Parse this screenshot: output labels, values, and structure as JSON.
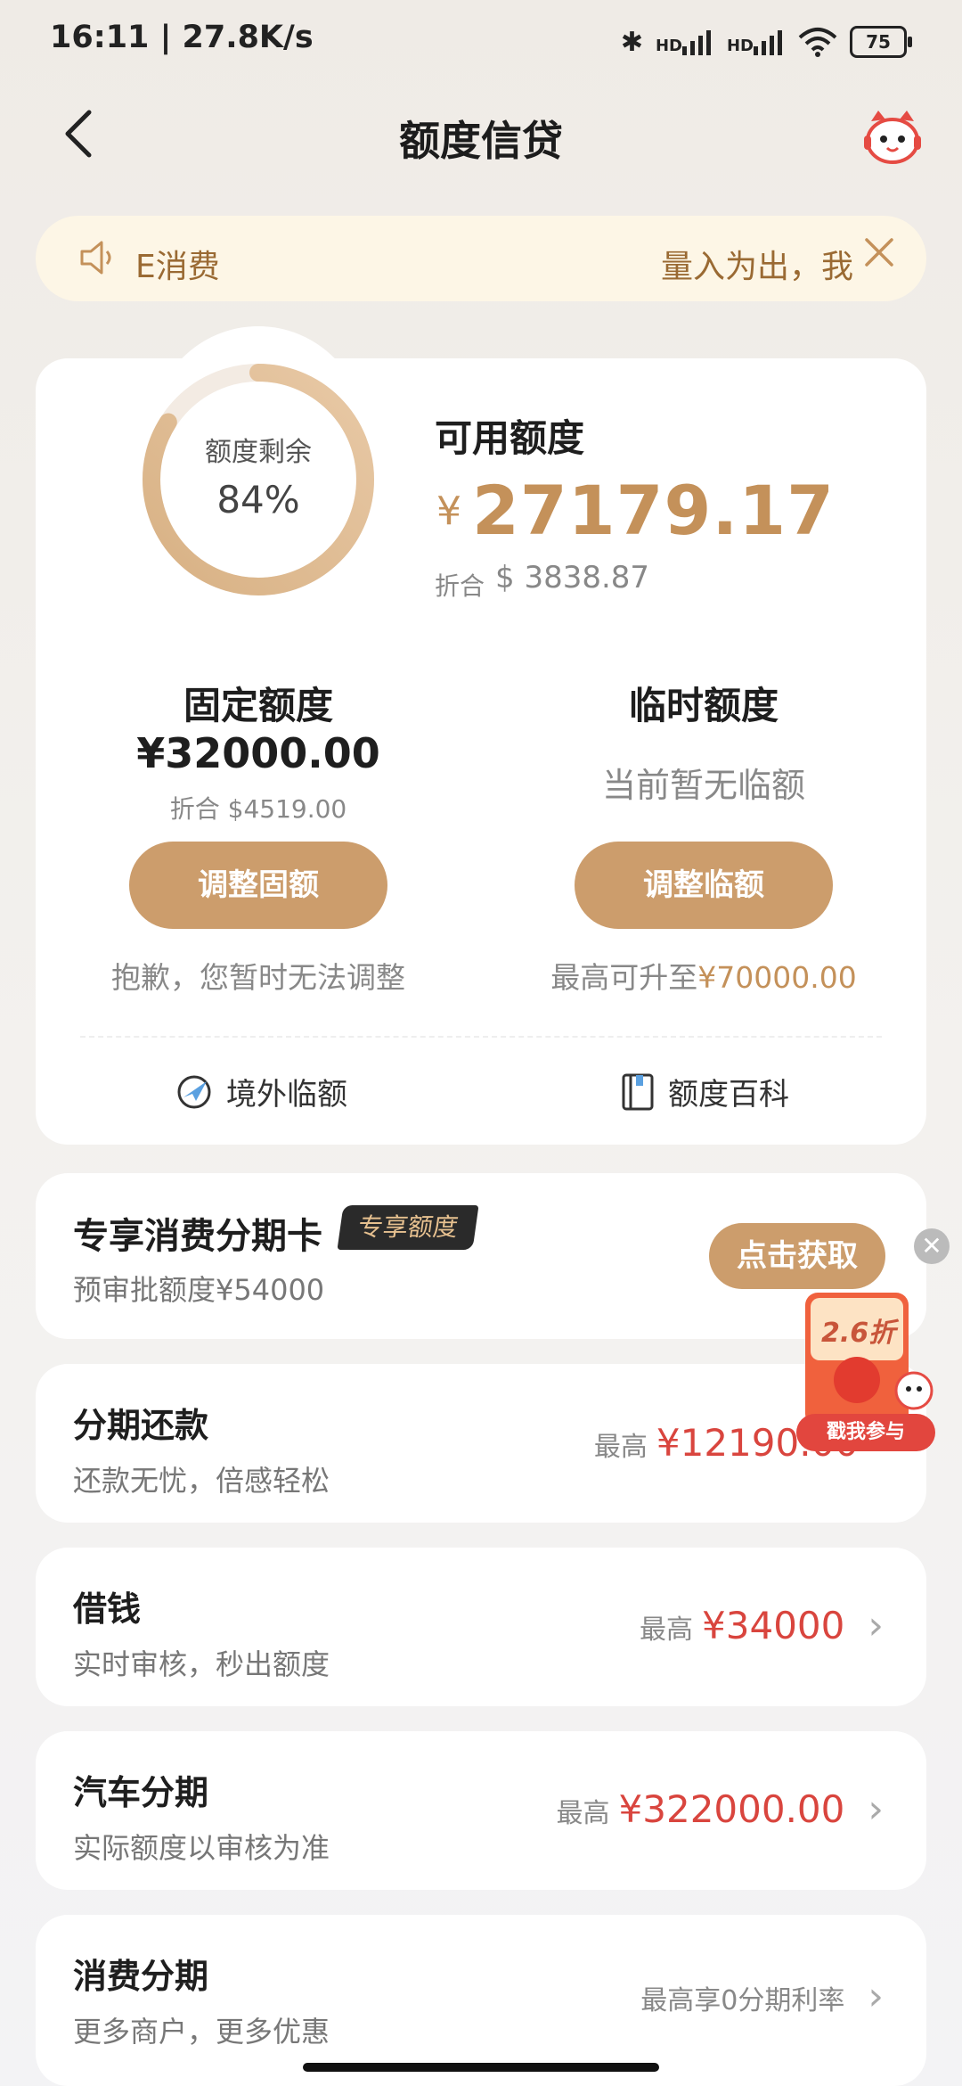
{
  "status_bar": {
    "time": "16:11 | 27.8K/s",
    "network_1": "HD",
    "network_2": "HD",
    "battery": "75"
  },
  "header": {
    "title": "额度信贷"
  },
  "notice": {
    "text_left": "E消费",
    "text_right": "量入为出，我"
  },
  "quota": {
    "ring_label": "额度剩余",
    "ring_percent": "84%",
    "ring_fraction": 0.84,
    "available_title": "可用额度",
    "currency_symbol": "¥",
    "available_value": "27179.17",
    "convert_label": "折合",
    "convert_value": "$ 3838.87",
    "fixed": {
      "title": "固定额度",
      "value": "¥32000.00",
      "convert": "折合 $4519.00",
      "button": "调整固额",
      "note": "抱歉，您暂时无法调整"
    },
    "temporary": {
      "title": "临时额度",
      "status": "当前暂无临额",
      "button": "调整临额",
      "note_prefix": "最高可升至",
      "note_value": "¥70000.00"
    },
    "links": {
      "overseas": "境外临额",
      "wiki": "额度百科"
    }
  },
  "promo": {
    "title": "专享消费分期卡",
    "badge": "专享额度",
    "subtitle": "预审批额度¥54000",
    "button": "点击获取"
  },
  "rows": [
    {
      "title": "分期还款",
      "subtitle": "还款无忧，倍感轻松",
      "prefix": "最高",
      "amount": "¥12190.00"
    },
    {
      "title": "借钱",
      "subtitle": "实时审核，秒出额度",
      "prefix": "最高",
      "amount": "¥34000"
    },
    {
      "title": "汽车分期",
      "subtitle": "实际额度以审核为准",
      "prefix": "最高",
      "amount": "¥322000.00"
    },
    {
      "title": "消费分期",
      "subtitle": "更多商户，更多优惠",
      "prefix": "最高享0分期利率",
      "amount": ""
    }
  ],
  "floating_ad": {
    "discount": "2.6折",
    "button": "戳我参与"
  },
  "colors": {
    "gold": "#c4915a",
    "button_gold": "#cc9d6c",
    "amount_red": "#d9453e",
    "notice_bg": "#fdf6e6"
  }
}
